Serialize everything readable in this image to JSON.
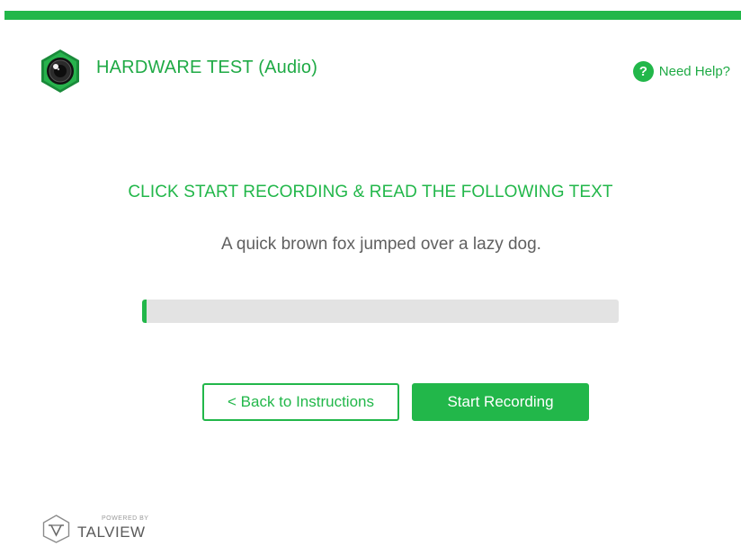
{
  "header": {
    "title": "HARDWARE TEST (Audio)",
    "help_label": "Need Help?"
  },
  "main": {
    "instruction": "CLICK START RECORDING & READ THE FOLLOWING TEXT",
    "read_text": "A quick brown fox jumped over a lazy dog.",
    "recording_progress_percent": 1,
    "back_button_label": "< Back to Instructions",
    "start_button_label": "Start Recording"
  },
  "footer": {
    "powered_by": "POWERED BY",
    "brand": "TALVIEW"
  },
  "icons": {
    "logo": "camera-lens-icon",
    "help": "question-circle-icon",
    "footer_logo": "talview-logo-icon"
  },
  "colors": {
    "accent": "#22b74a",
    "track": "#e3e3e3",
    "body_text": "#606060"
  }
}
